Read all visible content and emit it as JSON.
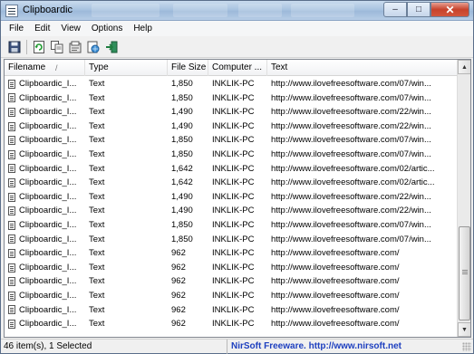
{
  "window": {
    "title": "Clipboardic"
  },
  "menu": [
    "File",
    "Edit",
    "View",
    "Options",
    "Help"
  ],
  "toolbar": [
    {
      "icon": "save-icon"
    },
    {
      "icon": "refresh-icon"
    },
    {
      "icon": "copy-icon"
    },
    {
      "icon": "properties-icon"
    },
    {
      "icon": "html-report-icon"
    },
    {
      "icon": "exit-icon"
    }
  ],
  "columns": [
    "Filename",
    "Type",
    "File Size",
    "Computer ...",
    "Text"
  ],
  "rows": [
    [
      "Clipboardic_I...",
      "Text",
      "1,850",
      "INKLIK-PC",
      "http://www.ilovefreesoftware.com/07/win..."
    ],
    [
      "Clipboardic_I...",
      "Text",
      "1,850",
      "INKLIK-PC",
      "http://www.ilovefreesoftware.com/07/win..."
    ],
    [
      "Clipboardic_I...",
      "Text",
      "1,490",
      "INKLIK-PC",
      "http://www.ilovefreesoftware.com/22/win..."
    ],
    [
      "Clipboardic_I...",
      "Text",
      "1,490",
      "INKLIK-PC",
      "http://www.ilovefreesoftware.com/22/win..."
    ],
    [
      "Clipboardic_I...",
      "Text",
      "1,850",
      "INKLIK-PC",
      "http://www.ilovefreesoftware.com/07/win..."
    ],
    [
      "Clipboardic_I...",
      "Text",
      "1,850",
      "INKLIK-PC",
      "http://www.ilovefreesoftware.com/07/win..."
    ],
    [
      "Clipboardic_I...",
      "Text",
      "1,642",
      "INKLIK-PC",
      "http://www.ilovefreesoftware.com/02/artic..."
    ],
    [
      "Clipboardic_I...",
      "Text",
      "1,642",
      "INKLIK-PC",
      "http://www.ilovefreesoftware.com/02/artic..."
    ],
    [
      "Clipboardic_I...",
      "Text",
      "1,490",
      "INKLIK-PC",
      "http://www.ilovefreesoftware.com/22/win..."
    ],
    [
      "Clipboardic_I...",
      "Text",
      "1,490",
      "INKLIK-PC",
      "http://www.ilovefreesoftware.com/22/win..."
    ],
    [
      "Clipboardic_I...",
      "Text",
      "1,850",
      "INKLIK-PC",
      "http://www.ilovefreesoftware.com/07/win..."
    ],
    [
      "Clipboardic_I...",
      "Text",
      "1,850",
      "INKLIK-PC",
      "http://www.ilovefreesoftware.com/07/win..."
    ],
    [
      "Clipboardic_I...",
      "Text",
      "962",
      "INKLIK-PC",
      "http://www.ilovefreesoftware.com/"
    ],
    [
      "Clipboardic_I...",
      "Text",
      "962",
      "INKLIK-PC",
      "http://www.ilovefreesoftware.com/"
    ],
    [
      "Clipboardic_I...",
      "Text",
      "962",
      "INKLIK-PC",
      "http://www.ilovefreesoftware.com/"
    ],
    [
      "Clipboardic_I...",
      "Text",
      "962",
      "INKLIK-PC",
      "http://www.ilovefreesoftware.com/"
    ],
    [
      "Clipboardic_I...",
      "Text",
      "962",
      "INKLIK-PC",
      "http://www.ilovefreesoftware.com/"
    ],
    [
      "Clipboardic_I...",
      "Text",
      "962",
      "INKLIK-PC",
      "http://www.ilovefreesoftware.com/"
    ]
  ],
  "status": {
    "items": "46 item(s), 1 Selected",
    "credit": "NirSoft Freeware.  http://www.nirsoft.net"
  },
  "colors": {
    "credit": "#1d3fbf",
    "close_button": "#c7432c"
  }
}
